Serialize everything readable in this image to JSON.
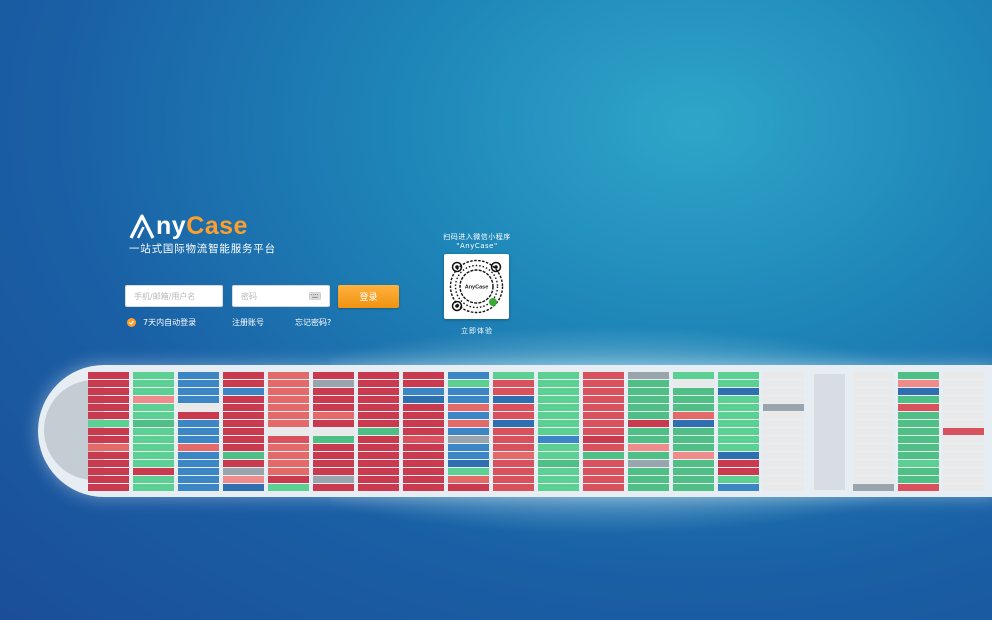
{
  "brand": {
    "logo_part1": "ny",
    "logo_part2": "Case",
    "slogan": "一站式国际物流智能服务平台"
  },
  "login_form": {
    "username_placeholder": "手机/邮箱/用户名",
    "password_placeholder": "密码",
    "login_label": "登录",
    "remember_label": "7天内自动登录",
    "register_label": "注册账号",
    "forgot_label": "忘记密码?"
  },
  "mini_program": {
    "caption_line1": "扫码进入微信小程序",
    "caption_line2": "\"AnyCase\"",
    "qr_logo_text": "AnyCase",
    "trial_label": "立即体验"
  },
  "colors": {
    "accent": "#ff9f2b",
    "button_gradient_top": "#ffb23e",
    "button_gradient_bottom": "#f19212",
    "sea_dark": "#1a4e98",
    "sea_light": "#2fa6c9"
  },
  "icons": {
    "logo_mark": "a-triangle-logo-icon",
    "keyboard": "keyboard-icon",
    "checkbox": "check-circle-icon",
    "qr_code": "qr-code-icon"
  }
}
